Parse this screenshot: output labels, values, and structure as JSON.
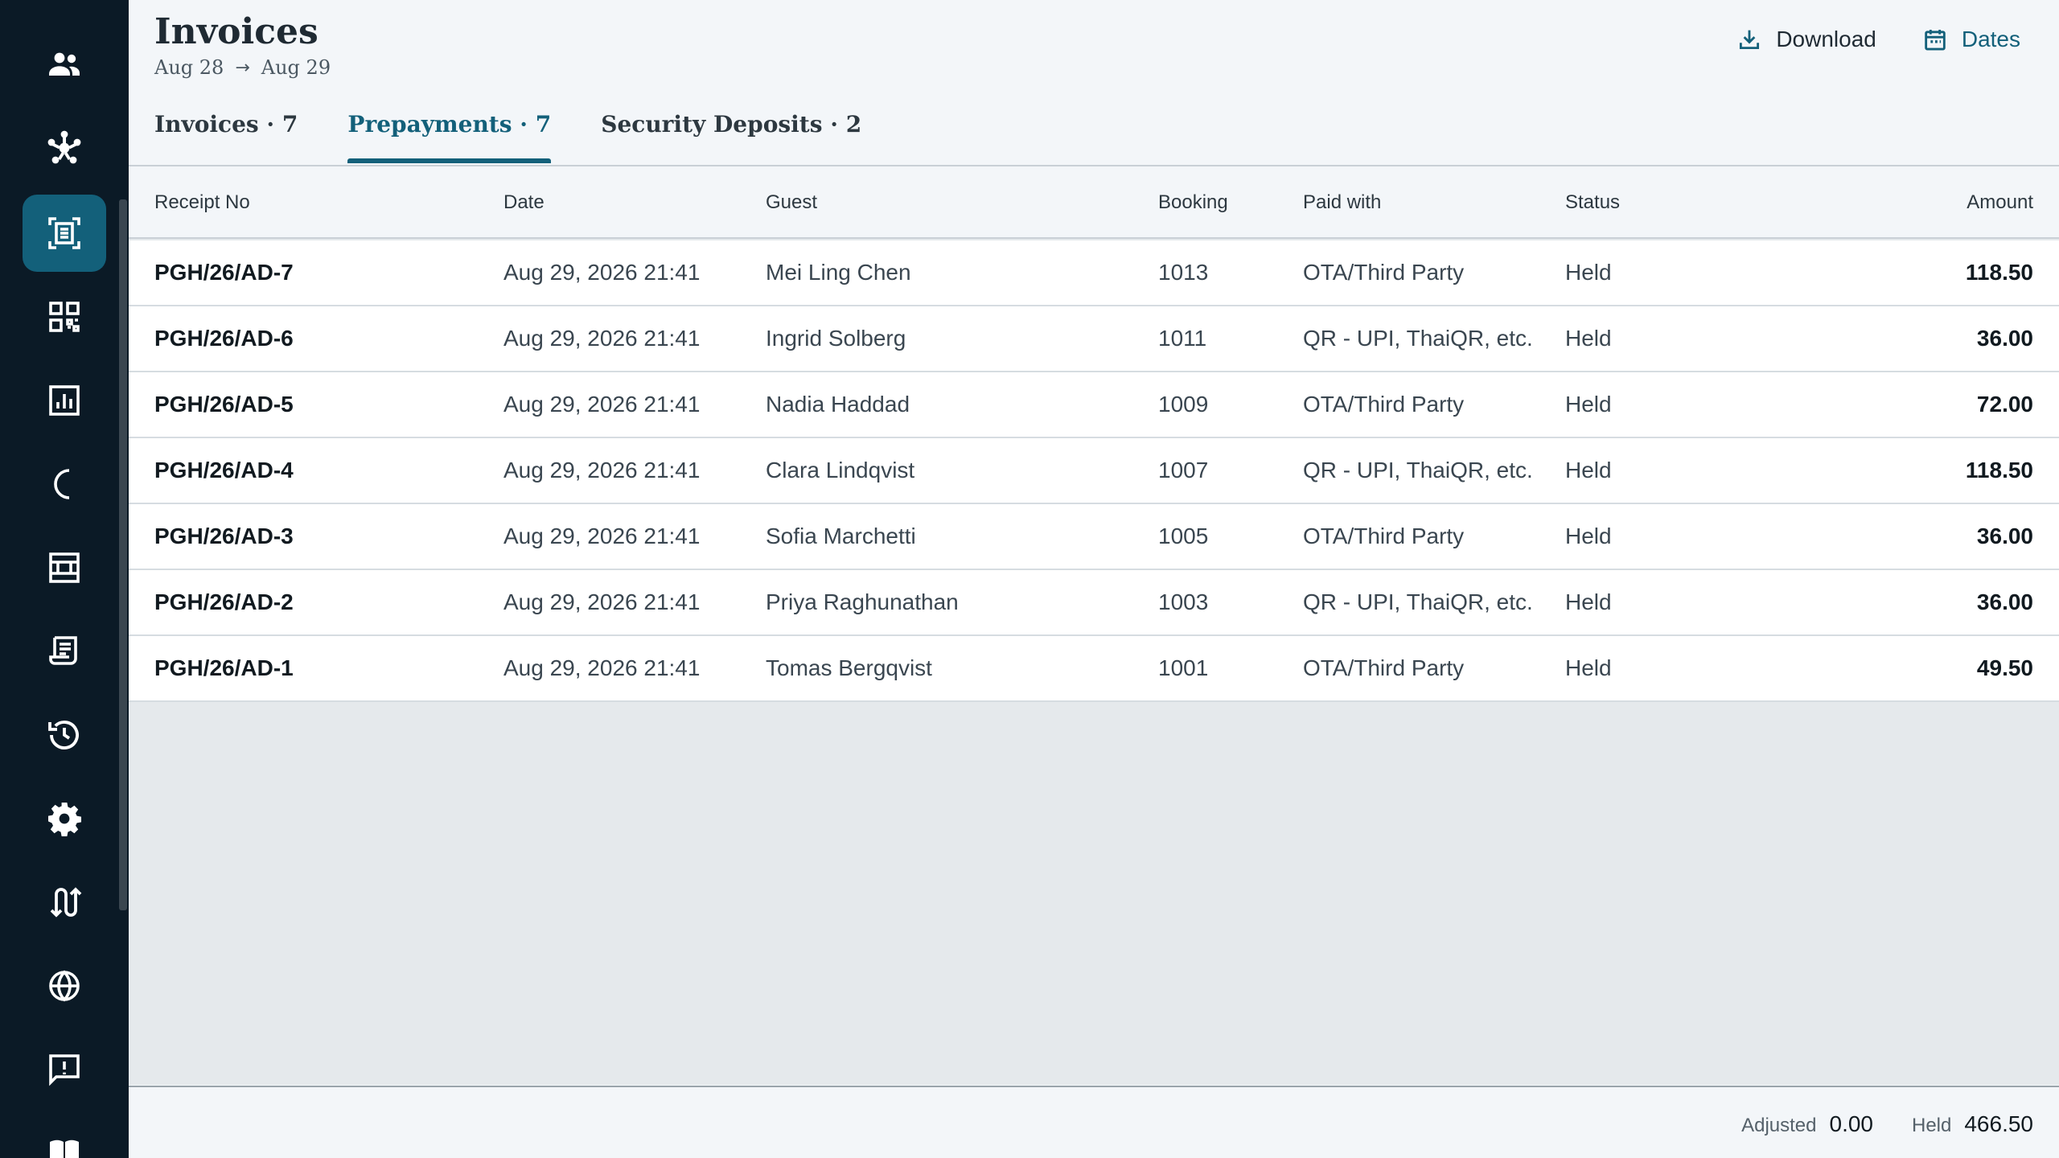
{
  "sidebar": {
    "items": [
      {
        "icon": "people-icon",
        "active": false
      },
      {
        "icon": "hub-icon",
        "active": false
      },
      {
        "icon": "receipt-scan-icon",
        "active": true
      },
      {
        "icon": "qr-code-icon",
        "active": false
      },
      {
        "icon": "report-chart-icon",
        "active": false
      },
      {
        "icon": "moon-icon",
        "active": false
      },
      {
        "icon": "room-layout-icon",
        "active": false
      },
      {
        "icon": "receipt-long-icon",
        "active": false
      },
      {
        "icon": "history-icon",
        "active": false
      },
      {
        "icon": "gear-icon",
        "active": false
      },
      {
        "icon": "swap-route-icon",
        "active": false
      },
      {
        "icon": "globe-icon",
        "active": false
      },
      {
        "icon": "feedback-icon",
        "active": false
      },
      {
        "icon": "book-icon",
        "active": false
      }
    ]
  },
  "header": {
    "title": "Invoices",
    "date_from": "Aug 28",
    "date_to": "Aug 29",
    "download_label": "Download",
    "dates_label": "Dates"
  },
  "tabs": [
    {
      "label": "Invoices · 7",
      "active": false
    },
    {
      "label": "Prepayments · 7",
      "active": true
    },
    {
      "label": "Security Deposits · 2",
      "active": false
    }
  ],
  "table": {
    "columns": {
      "receipt": "Receipt No",
      "date": "Date",
      "guest": "Guest",
      "booking": "Booking",
      "paid": "Paid with",
      "status": "Status",
      "amount": "Amount"
    },
    "rows": [
      {
        "receipt": "PGH/26/AD-7",
        "date": "Aug 29, 2026 21:41",
        "guest": "Mei Ling Chen",
        "booking": "1013",
        "paid": "OTA/Third Party",
        "status": "Held",
        "amount": "118.50"
      },
      {
        "receipt": "PGH/26/AD-6",
        "date": "Aug 29, 2026 21:41",
        "guest": "Ingrid Solberg",
        "booking": "1011",
        "paid": "QR - UPI, ThaiQR, etc.",
        "status": "Held",
        "amount": "36.00"
      },
      {
        "receipt": "PGH/26/AD-5",
        "date": "Aug 29, 2026 21:41",
        "guest": "Nadia Haddad",
        "booking": "1009",
        "paid": "OTA/Third Party",
        "status": "Held",
        "amount": "72.00"
      },
      {
        "receipt": "PGH/26/AD-4",
        "date": "Aug 29, 2026 21:41",
        "guest": "Clara Lindqvist",
        "booking": "1007",
        "paid": "QR - UPI, ThaiQR, etc.",
        "status": "Held",
        "amount": "118.50"
      },
      {
        "receipt": "PGH/26/AD-3",
        "date": "Aug 29, 2026 21:41",
        "guest": "Sofia Marchetti",
        "booking": "1005",
        "paid": "OTA/Third Party",
        "status": "Held",
        "amount": "36.00"
      },
      {
        "receipt": "PGH/26/AD-2",
        "date": "Aug 29, 2026 21:41",
        "guest": "Priya Raghunathan",
        "booking": "1003",
        "paid": "QR - UPI, ThaiQR, etc.",
        "status": "Held",
        "amount": "36.00"
      },
      {
        "receipt": "PGH/26/AD-1",
        "date": "Aug 29, 2026 21:41",
        "guest": "Tomas Bergqvist",
        "booking": "1001",
        "paid": "OTA/Third Party",
        "status": "Held",
        "amount": "49.50"
      }
    ]
  },
  "footer": {
    "adjusted_label": "Adjusted",
    "adjusted_value": "0.00",
    "held_label": "Held",
    "held_value": "466.50"
  },
  "colors": {
    "sidebar_bg": "#0b1a26",
    "accent": "#13607a"
  }
}
